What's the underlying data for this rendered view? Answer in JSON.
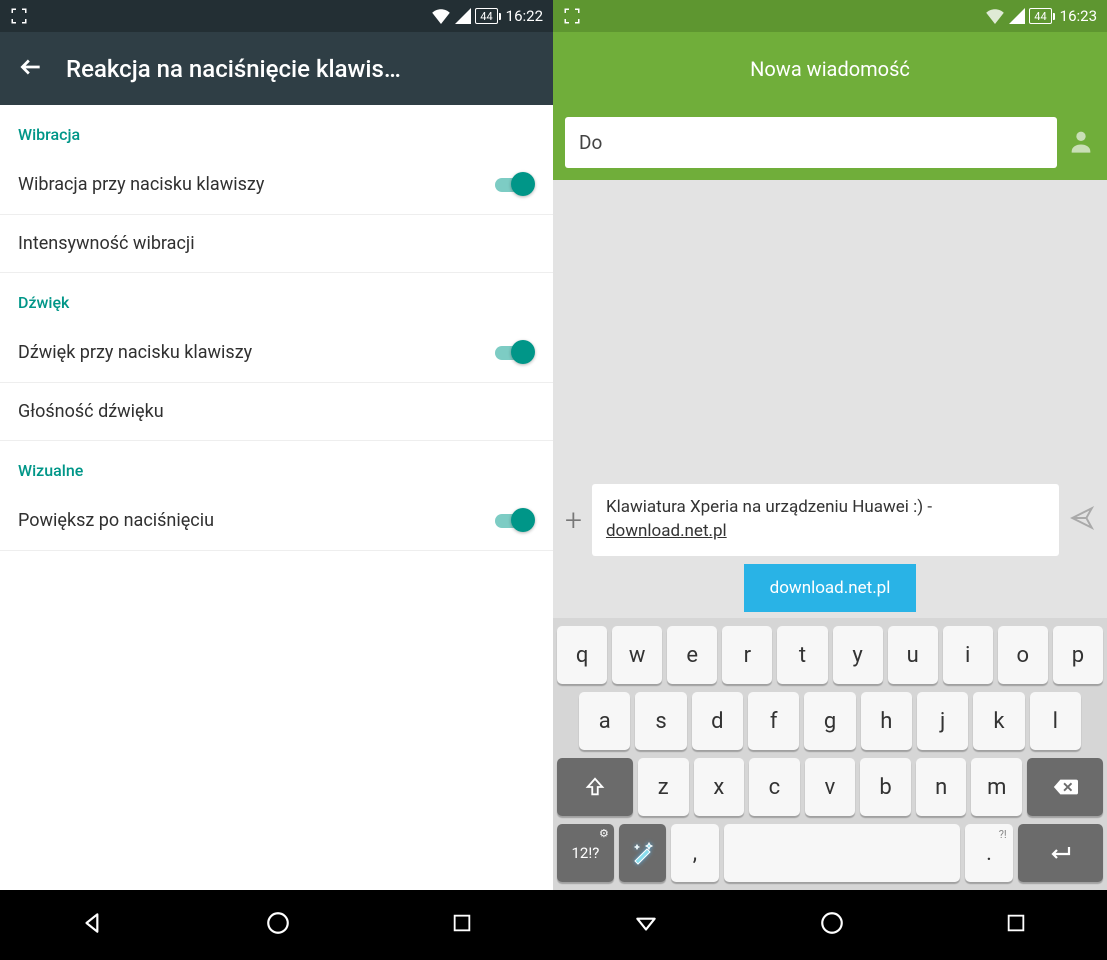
{
  "left": {
    "status": {
      "battery": "44",
      "time": "16:22"
    },
    "title": "Reakcja na naciśnięcie klawis…",
    "sections": {
      "vibration": {
        "header": "Wibracja",
        "toggle_label": "Wibracja przy nacisku klawiszy",
        "intensity_label": "Intensywność wibracji"
      },
      "sound": {
        "header": "Dźwięk",
        "toggle_label": "Dźwięk przy nacisku klawiszy",
        "volume_label": "Głośność dźwięku"
      },
      "visual": {
        "header": "Wizualne",
        "toggle_label": "Powiększ po naciśnięciu"
      }
    }
  },
  "right": {
    "status": {
      "battery": "44",
      "time": "16:23"
    },
    "title": "Nowa wiadomość",
    "to_label": "Do",
    "compose_text": "Klawiatura Xperia na urządzeniu Huawei :) - ",
    "compose_link": "download.net.pl",
    "suggestion": "download.net.pl",
    "keyboard": {
      "row1": [
        "q",
        "w",
        "e",
        "r",
        "t",
        "y",
        "u",
        "i",
        "o",
        "p"
      ],
      "row2": [
        "a",
        "s",
        "d",
        "f",
        "g",
        "h",
        "j",
        "k",
        "l"
      ],
      "row3": [
        "z",
        "x",
        "c",
        "v",
        "b",
        "n",
        "m"
      ],
      "sym_key": "12!?",
      "comma": ",",
      "period": ".",
      "period_alt": "?!"
    }
  }
}
